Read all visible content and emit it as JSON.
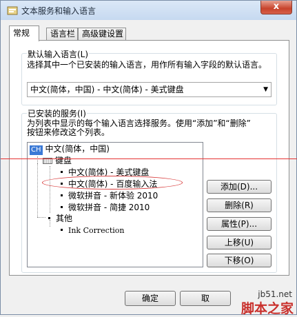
{
  "window": {
    "title": "文本服务和输入语言",
    "close": "x"
  },
  "tabs": [
    {
      "label": "常规"
    },
    {
      "label": "语言栏"
    },
    {
      "label": "高级键设置"
    }
  ],
  "default_language": {
    "group_label": "默认输入语言(L)",
    "description": "选择其中一个已安装的输入语言，用作所有输入字段的默认语言。",
    "selected": "中文(简体，中国) - 中文(简体) - 美式键盘"
  },
  "installed_services": {
    "group_label": "已安装的服务(I)",
    "description_line1": "为列表中显示的每个输入语言选择服务。使用“添加”和“删除”",
    "description_line2": "按钮来修改这个列表。",
    "tree": {
      "language_badge": "CH",
      "language": "中文(简体，中国)",
      "keyboard_group": "键盘",
      "keyboards": [
        "中文(简体) - 美式键盘",
        "中文(简体) - 百度输入法",
        "微软拼音 - 新体验 2010",
        "微软拼音 - 简捷 2010"
      ],
      "other_group": "其他",
      "others": [
        "Ink Correction"
      ]
    }
  },
  "buttons": {
    "add": "添加(D)...",
    "remove": "删除(R)",
    "properties": "属性(P)...",
    "move_up": "上移(U)",
    "move_down": "下移(O)",
    "ok": "确定",
    "cancel": "取"
  },
  "watermark": {
    "url": "jb51.net",
    "name": "脚本之家"
  },
  "annotation_color": "#d83a3a"
}
